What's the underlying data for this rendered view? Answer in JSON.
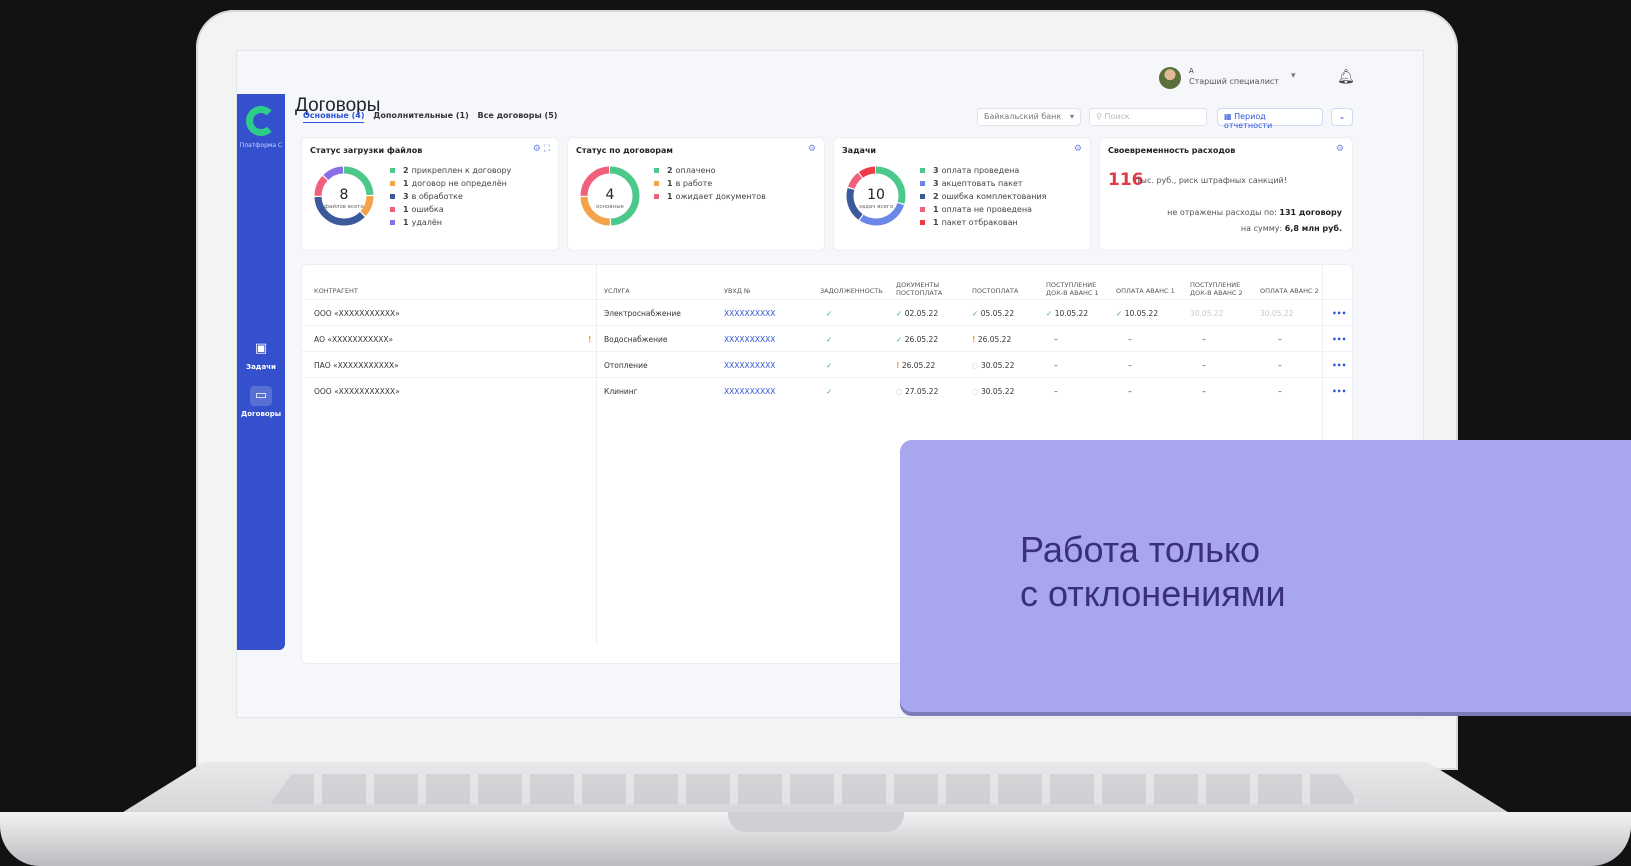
{
  "app": {
    "page_title": "Договоры",
    "logo_caption": "Платформа С"
  },
  "sidebar": {
    "items": [
      {
        "label": "Задачи"
      },
      {
        "label": "Договоры"
      }
    ]
  },
  "user": {
    "name": "А",
    "role": "Старший специалист"
  },
  "tabs": [
    {
      "label": "Основные (4)"
    },
    {
      "label": "Дополнительные (1)"
    },
    {
      "label": "Все договоры (5)"
    }
  ],
  "toolbar": {
    "bank": "Байкальский банк",
    "search_placeholder": "Поиск",
    "period_label": "Период отчетности"
  },
  "cards": {
    "files": {
      "title": "Статус загрузки файлов",
      "total": "8",
      "total_caption": "файлов всего",
      "legend": [
        {
          "count": "2",
          "text": "прикреплен к договору",
          "color": "#4cc98a",
          "fraction": 0.25
        },
        {
          "count": "1",
          "text": "договор не определён",
          "color": "#f5a34a",
          "fraction": 0.125
        },
        {
          "count": "3",
          "text": "в обработке",
          "color": "#3a5a9a",
          "fraction": 0.375
        },
        {
          "count": "1",
          "text": "ошибка",
          "color": "#f0607a",
          "fraction": 0.125
        },
        {
          "count": "1",
          "text": "удалён",
          "color": "#8a6fe8",
          "fraction": 0.125
        }
      ]
    },
    "contracts": {
      "title": "Статус по договорам",
      "total": "4",
      "total_caption": "основные",
      "legend": [
        {
          "count": "2",
          "text": "оплачено",
          "color": "#4cc98a",
          "fraction": 0.5
        },
        {
          "count": "1",
          "text": "в работе",
          "color": "#f5a34a",
          "fraction": 0.25
        },
        {
          "count": "1",
          "text": "ожидает документов",
          "color": "#f0607a",
          "fraction": 0.25
        }
      ]
    },
    "tasks": {
      "title": "Задачи",
      "total": "10",
      "total_caption": "задач всего",
      "legend": [
        {
          "count": "3",
          "text": "оплата проведена",
          "color": "#4cc98a",
          "fraction": 0.3
        },
        {
          "count": "3",
          "text": "акцептовать пакет",
          "color": "#6a86e6",
          "fraction": 0.3
        },
        {
          "count": "2",
          "text": "ошибка комплектования",
          "color": "#3a5a9a",
          "fraction": 0.2
        },
        {
          "count": "1",
          "text": "оплата не проведена",
          "color": "#f0607a",
          "fraction": 0.1
        },
        {
          "count": "1",
          "text": "пакет отбракован",
          "color": "#f03a46",
          "fraction": 0.1
        }
      ]
    },
    "expenses": {
      "title": "Своевременность расходов",
      "big_number": "116",
      "big_text": "тыс. руб., риск штрафных санкций!",
      "line1_text": "не отражены расходы по:",
      "line1_value": "131 договору",
      "line2_text": "на сумму:",
      "line2_value": "6,8 млн руб."
    }
  },
  "table": {
    "headers": [
      "КОНТРАГЕНТ",
      "УСЛУГА",
      "УВХД №",
      "ЗАДОЛЖЕННОСТЬ",
      "ДОКУМЕНТЫ ПОСТОПЛАТА",
      "ПОСТОПЛАТА",
      "ПОСТУПЛЕНИЕ ДОК-В АВАНС 1",
      "ОПЛАТА АВАНС 1",
      "ПОСТУПЛЕНИЕ ДОК-В АВАНС 2",
      "ОПЛАТА АВАНС 2"
    ],
    "rows": [
      {
        "contractor": "ООО «XXXXXXXXXXX»",
        "flag": "",
        "service": "Электроснабжение",
        "uvhd": "XXXXXXXXXX",
        "debt": "✓",
        "doc_post": "02.05.22",
        "doc_post_mark": "✓",
        "post": "05.05.22",
        "post_mark": "✓",
        "doc_a1": "10.05.22",
        "doc_a1_mark": "✓",
        "pay_a1": "10.05.22",
        "pay_a1_mark": "✓",
        "doc_a2": "30.05.22",
        "pay_a2": "30.05.22",
        "more": "•••"
      },
      {
        "contractor": "АО «XXXXXXXXXXX»",
        "flag": "!",
        "service": "Водоснабжение",
        "uvhd": "XXXXXXXXXX",
        "debt": "✓",
        "doc_post": "26.05.22",
        "doc_post_mark": "✓",
        "post": "26.05.22",
        "post_mark": "!",
        "doc_a1": "–",
        "doc_a1_mark": "",
        "pay_a1": "–",
        "pay_a1_mark": "",
        "doc_a2": "–",
        "pay_a2": "–",
        "more": "•••"
      },
      {
        "contractor": "ПАО «XXXXXXXXXXX»",
        "flag": "",
        "service": "Отопление",
        "uvhd": "XXXXXXXXXX",
        "debt": "✓",
        "doc_post": "26.05.22",
        "doc_post_mark": "!",
        "post": "30.05.22",
        "post_mark": "○",
        "doc_a1": "–",
        "doc_a1_mark": "",
        "pay_a1": "–",
        "pay_a1_mark": "",
        "doc_a2": "–",
        "pay_a2": "–",
        "more": "•••"
      },
      {
        "contractor": "ООО «XXXXXXXXXXX»",
        "flag": "",
        "service": "Клининг",
        "uvhd": "XXXXXXXXXX",
        "debt": "✓",
        "doc_post": "27.05.22",
        "doc_post_mark": "○",
        "post": "30.05.22",
        "post_mark": "○",
        "doc_a1": "–",
        "doc_a1_mark": "",
        "pay_a1": "–",
        "pay_a1_mark": "",
        "doc_a2": "–",
        "pay_a2": "–",
        "more": "•••"
      }
    ]
  },
  "overlay": {
    "line1": "Работа только",
    "line2": "с отклонениями"
  },
  "icons": {
    "bell": "bell-icon",
    "calendar": "calendar-icon",
    "settings": "gear-icon",
    "filter": "filter-icon"
  }
}
